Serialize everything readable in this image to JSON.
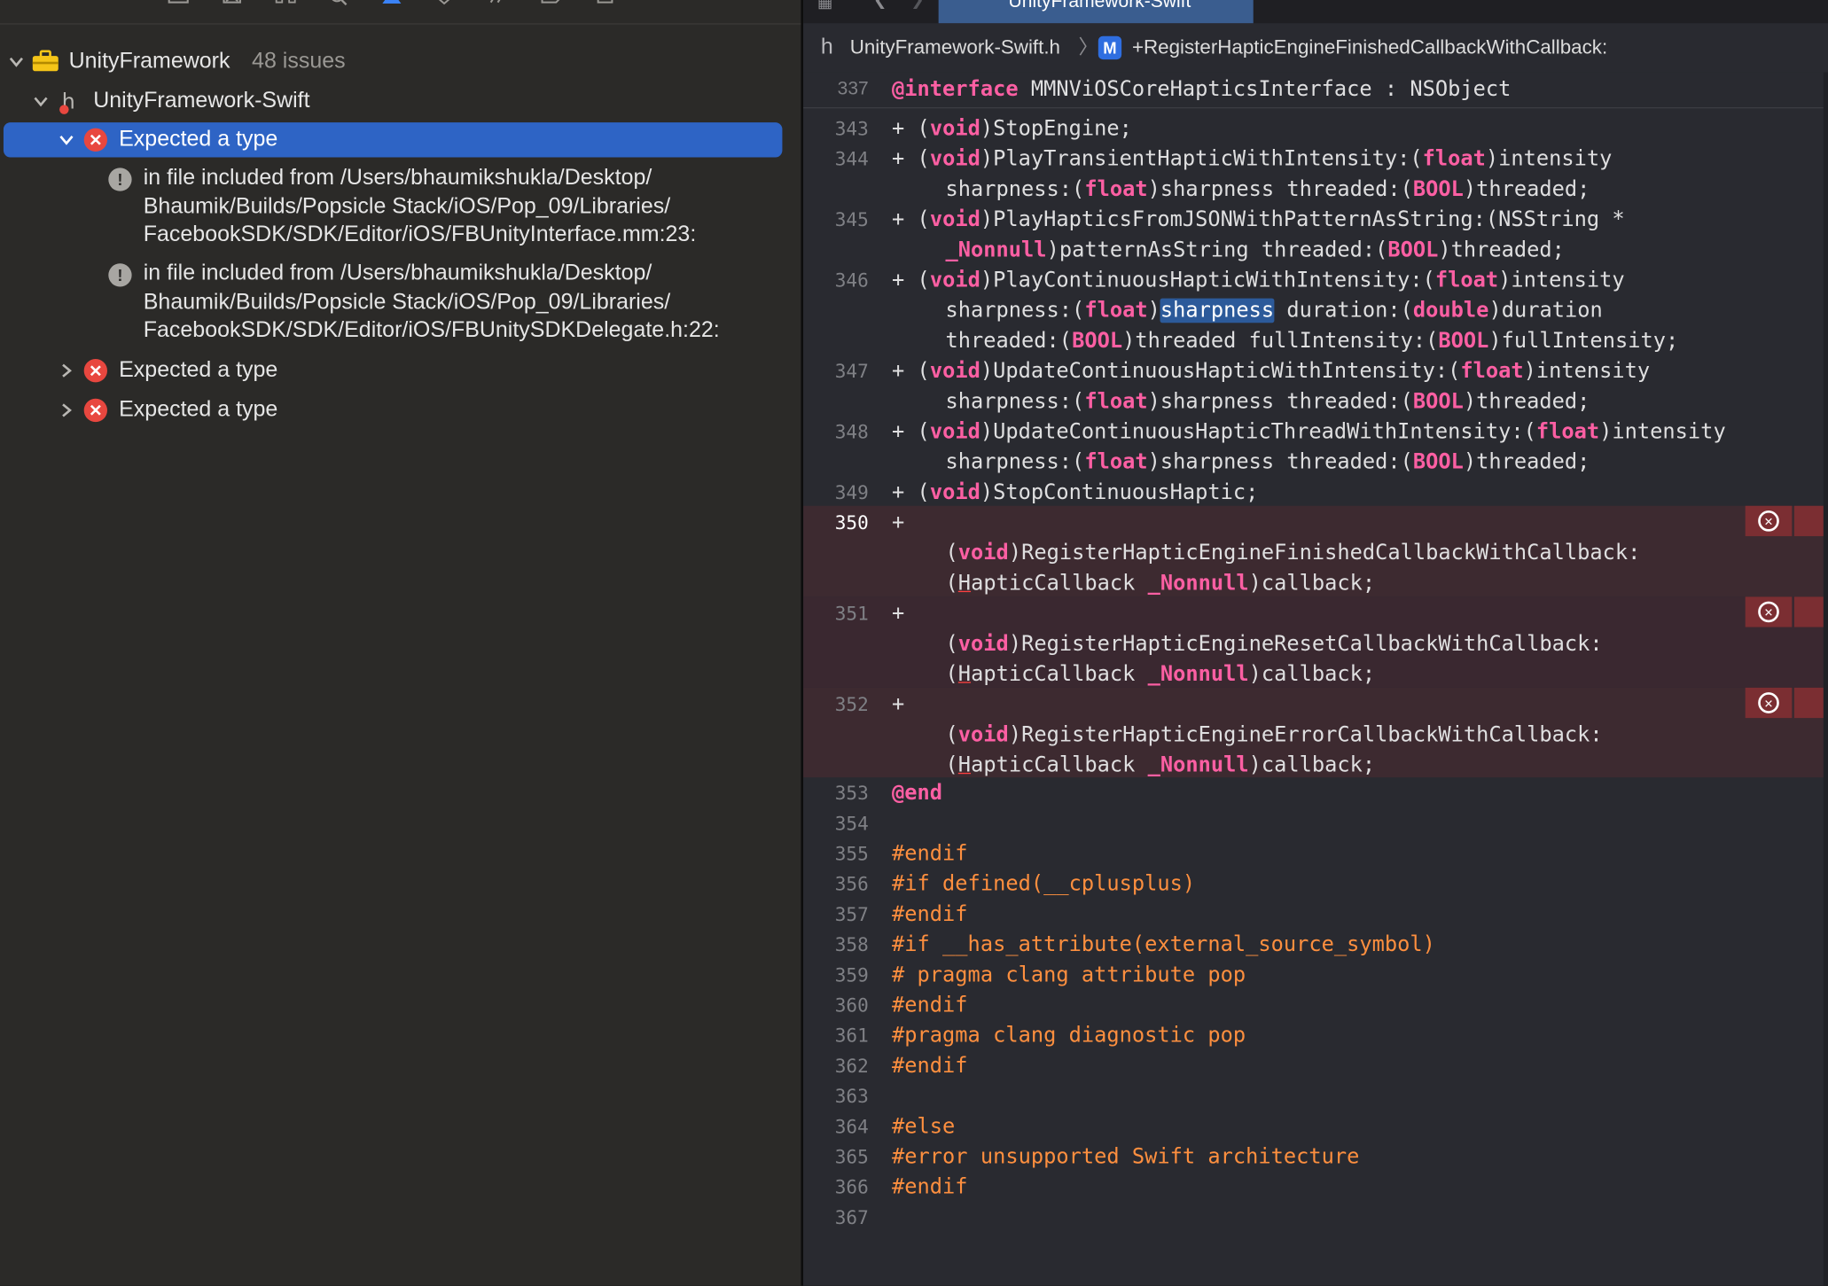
{
  "navigator": {
    "project_name": "UnityFramework",
    "issue_count": "48 issues",
    "file_name": "UnityFramework-Swift",
    "issues": [
      {
        "label": "Expected a type"
      },
      {
        "label": "Expected a type"
      },
      {
        "label": "Expected a type"
      }
    ],
    "notes": [
      [
        "in file included from /Users/bhaumikshukla/Desktop/",
        "Bhaumik/Builds/Popsicle Stack/iOS/Pop_09/Libraries/",
        "FacebookSDK/SDK/Editor/iOS/FBUnityInterface.mm:23:"
      ],
      [
        "in file included from /Users/bhaumikshukla/Desktop/",
        "Bhaumik/Builds/Popsicle Stack/iOS/Pop_09/Libraries/",
        "FacebookSDK/SDK/Editor/iOS/FBUnitySDKDelegate.h:22:"
      ]
    ]
  },
  "editor": {
    "tab_title": "UnityFramework-Swift",
    "jump_file": "UnityFramework-Swift.h",
    "jump_symbol": "+RegisterHapticEngineFinishedCallbackWithCallback:",
    "sticky_line_number": "337",
    "line_numbers": [
      "343",
      "344",
      "345",
      "346",
      "347",
      "348",
      "349",
      "350",
      "351",
      "352",
      "353",
      "354",
      "355",
      "356",
      "357",
      "358",
      "359",
      "360",
      "361",
      "362",
      "363",
      "364",
      "365",
      "366",
      "367"
    ]
  },
  "colors": {
    "keyword": "#fc5fa3",
    "preprocessor": "#fd8f3f",
    "selection": "#2e64c5",
    "error": "#e8473f"
  }
}
